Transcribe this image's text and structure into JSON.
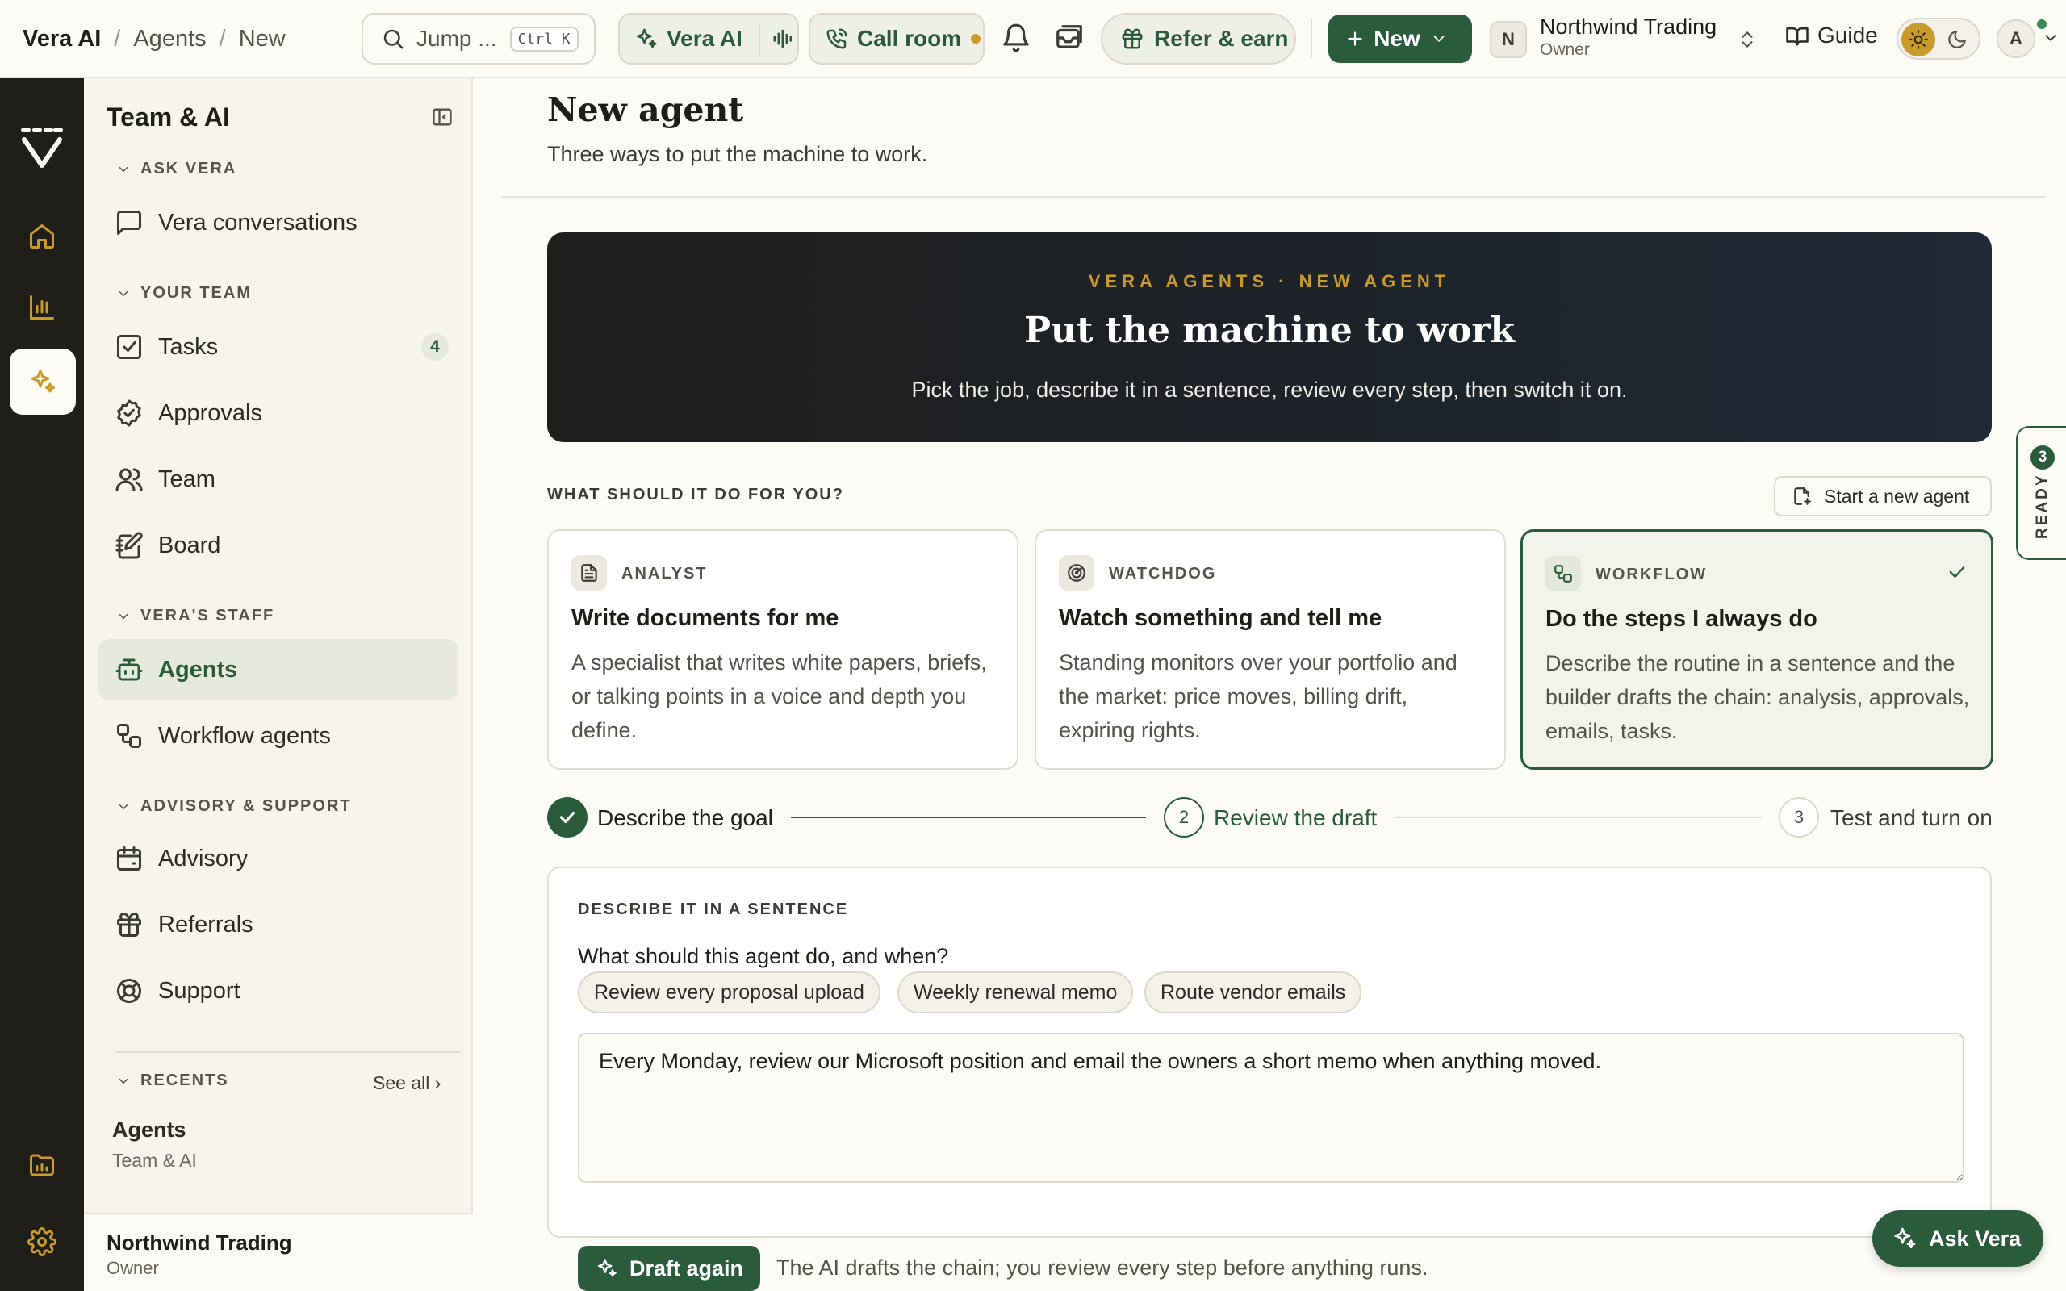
{
  "breadcrumb": {
    "root": "Vera AI",
    "items": [
      "Agents",
      "New"
    ]
  },
  "topbar": {
    "jump": {
      "label": "Jump ...",
      "shortcut": "Ctrl K"
    },
    "vera_ai": "Vera AI",
    "call_room": "Call room",
    "refer": "Refer & earn",
    "new": "New",
    "org": {
      "initial": "N",
      "name": "Northwind Trading",
      "role": "Owner"
    },
    "guide": "Guide",
    "user_initial": "A"
  },
  "sidebar": {
    "title": "Team & AI",
    "sections": {
      "ask_vera": "ASK VERA",
      "your_team": "YOUR TEAM",
      "veras_staff": "VERA'S STAFF",
      "advisory": "ADVISORY & SUPPORT",
      "recents": "RECENTS"
    },
    "items": {
      "vera_conversations": "Vera conversations",
      "tasks": "Tasks",
      "tasks_badge": "4",
      "approvals": "Approvals",
      "team": "Team",
      "board": "Board",
      "agents": "Agents",
      "workflow_agents": "Workflow agents",
      "advisory": "Advisory",
      "referrals": "Referrals",
      "support": "Support"
    },
    "see_all": "See all ›",
    "recent": {
      "title": "Agents",
      "sub": "Team & AI"
    },
    "footer": {
      "name": "Northwind Trading",
      "role": "Owner"
    }
  },
  "page": {
    "title": "New agent",
    "subtitle": "Three ways to put the machine to work."
  },
  "hero": {
    "eyebrow": "VERA AGENTS · NEW AGENT",
    "title": "Put the machine to work",
    "subtitle": "Pick the job, describe it in a sentence, review every step, then switch it on."
  },
  "question": {
    "label": "WHAT SHOULD IT DO FOR YOU?",
    "start_new": "Start a new agent"
  },
  "cards": [
    {
      "kind": "ANALYST",
      "title": "Write documents for me",
      "desc": "A specialist that writes white papers, briefs, or talking points in a voice and depth you define."
    },
    {
      "kind": "WATCHDOG",
      "title": "Watch something and tell me",
      "desc": "Standing monitors over your portfolio and the market: price moves, billing drift, expiring rights."
    },
    {
      "kind": "WORKFLOW",
      "title": "Do the steps I always do",
      "desc": "Describe the routine in a sentence and the builder drafts the chain: analysis, approvals, emails, tasks."
    }
  ],
  "steps": [
    {
      "num": "1",
      "label": "Describe the goal",
      "state": "done"
    },
    {
      "num": "2",
      "label": "Review the draft",
      "state": "current"
    },
    {
      "num": "3",
      "label": "Test and turn on",
      "state": "pending"
    }
  ],
  "describe": {
    "label": "DESCRIBE IT IN A SENTENCE",
    "question": "What should this agent do, and when?",
    "chips": [
      "Review every proposal upload",
      "Weekly renewal memo",
      "Route vendor emails"
    ],
    "text": "Every Monday, review our Microsoft position and email the owners a short memo when anything moved."
  },
  "actions": {
    "draft_again": "Draft again",
    "note": "The AI drafts the chain; you review every step before anything runs."
  },
  "ready": {
    "count": "3",
    "label": "READY"
  },
  "ask_vera": "Ask Vera",
  "colors": {
    "brand": "#2a5c3b",
    "accent": "#c89b2b",
    "rail": "#1f1e19"
  }
}
